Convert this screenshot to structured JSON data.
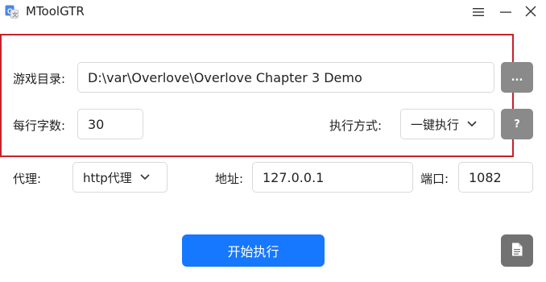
{
  "window": {
    "title": "MToolGTR"
  },
  "game_dir": {
    "label": "游戏目录:",
    "value": "D:\\var\\Overlove\\Overlove Chapter 3 Demo",
    "browse_label": "..."
  },
  "chars_per_line": {
    "label": "每行字数:",
    "value": "30"
  },
  "exec_mode": {
    "label": "执行方式:",
    "selected": "一键执行",
    "help_label": "?"
  },
  "proxy": {
    "label": "代理:",
    "type_selected": "http代理",
    "address_label": "地址:",
    "address_value": "127.0.0.1",
    "port_label": "端口:",
    "port_value": "1082"
  },
  "actions": {
    "start_label": "开始执行"
  },
  "colors": {
    "highlight": "#c8202a",
    "primary": "#1677ff",
    "gray_button": "#8a8a8a"
  },
  "icons": {
    "app": "app-logo-icon",
    "menu": "hamburger-icon",
    "minimize": "minimize-icon",
    "close": "close-icon",
    "dropdown": "chevron-down-icon",
    "log": "document-icon"
  }
}
